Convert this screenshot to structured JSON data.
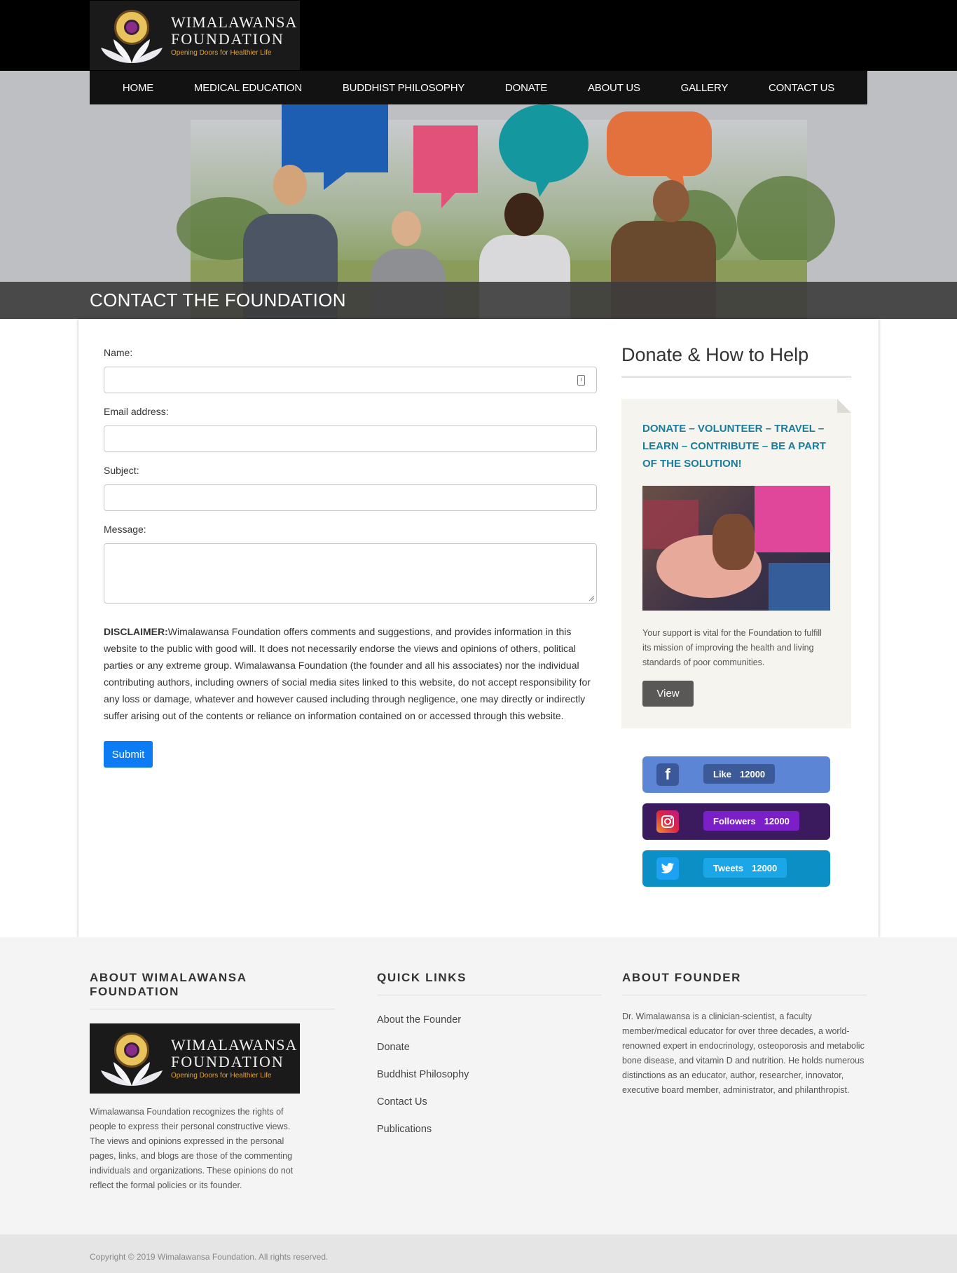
{
  "brand": {
    "name_line1": "WIMALAWANSA",
    "name_line2": "FOUNDATION",
    "tagline": "Opening Doors for Healthier Life"
  },
  "nav": {
    "items": [
      "HOME",
      "MEDICAL EDUCATION",
      "BUDDHIST PHILOSOPHY",
      "DONATE",
      "ABOUT US",
      "GALLERY",
      "CONTACT US"
    ]
  },
  "page": {
    "title": "CONTACT THE FOUNDATION"
  },
  "form": {
    "name_label": "Name:",
    "name_value": "",
    "email_label": "Email address:",
    "email_value": "",
    "subject_label": "Subject:",
    "subject_value": "",
    "message_label": "Message:",
    "message_value": "",
    "disclaimer_title": "DISCLAIMER:",
    "disclaimer_text": "Wimalawansa Foundation offers comments and suggestions, and provides information in this website to the public with good will. It does not necessarily endorse the views and opinions of others, political parties or any extreme group. Wimalawansa Foundation (the founder and all his associates) nor the individual contributing authors, including owners of social media sites linked to this website, do not accept responsibility for any loss or damage, whatever and however caused including through negligence, one may directly or indirectly suffer arising out of the contents or reliance on information contained on or accessed through this website.",
    "submit_label": "Submit"
  },
  "sidebar": {
    "title": "Donate & How to Help",
    "card_heading": "DONATE – VOLUNTEER – TRAVEL – LEARN – CONTRIBUTE – BE A PART OF THE SOLUTION!",
    "card_text": "Your support is vital for the Foundation to fulfill its mission of improving the health and living standards of poor communities.",
    "view_label": "View",
    "social": [
      {
        "network": "facebook",
        "icon": "facebook-icon",
        "label": "Like",
        "count": "12000",
        "color": "#5c85d6",
        "pill": "#3d5a98"
      },
      {
        "network": "instagram",
        "icon": "instagram-icon",
        "label": "Followers",
        "count": "12000",
        "color": "#3c1a5e",
        "pill": "#7b1fc7"
      },
      {
        "network": "twitter",
        "icon": "twitter-icon",
        "label": "Tweets",
        "count": "12000",
        "color": "#0c8fc4",
        "pill": "#1ba6e8"
      }
    ]
  },
  "footer": {
    "about_title": "ABOUT WIMALAWANSA FOUNDATION",
    "about_text": "Wimalawansa Foundation recognizes the rights of people to express their personal constructive views. The views and opinions expressed in the personal pages, links, and blogs are those of the commenting individuals and organizations. These opinions do not reflect the formal policies or its founder.",
    "links_title": "QUICK LINKS",
    "links": [
      "About the Founder",
      "Donate",
      "Buddhist Philosophy",
      "Contact Us",
      "Publications"
    ],
    "founder_title": "ABOUT FOUNDER",
    "founder_text": "Dr. Wimalawansa is a clinician-scientist, a faculty member/medical educator for over three decades, a world-renowned expert in endocrinology, osteoporosis and metabolic bone disease, and vitamin D and nutrition. He holds numerous distinctions as an educator, author, researcher, innovator, executive board member, administrator, and philanthropist.",
    "copyright": "Copyright © 2019 Wimalawansa Foundation. All rights reserved."
  }
}
